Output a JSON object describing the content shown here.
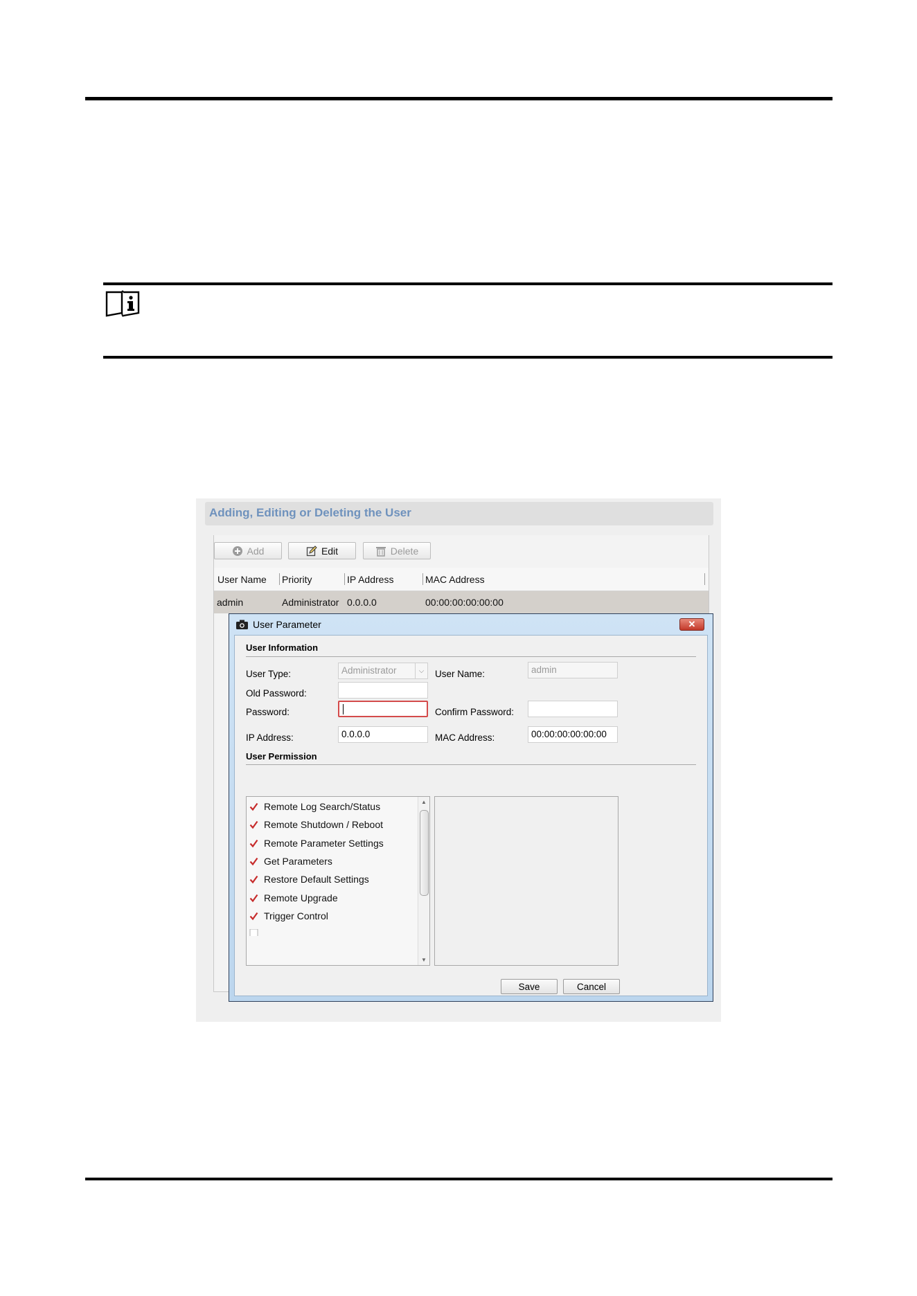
{
  "screenshot": {
    "header_title": "Adding, Editing or Deleting the User",
    "toolbar": {
      "add": "Add",
      "edit": "Edit",
      "delete": "Delete"
    },
    "table": {
      "columns": [
        "User Name",
        "Priority",
        "IP Address",
        "MAC Address"
      ],
      "rows": [
        {
          "user_name": "admin",
          "priority": "Administrator",
          "ip": "0.0.0.0",
          "mac": "00:00:00:00:00:00"
        }
      ]
    },
    "dialog": {
      "title": "User Parameter",
      "section_info": "User Information",
      "user_type_label": "User Type:",
      "user_type_value": "Administrator",
      "user_name_label": "User Name:",
      "user_name_value": "admin",
      "old_password_label": "Old Password:",
      "password_label": "Password:",
      "confirm_password_label": "Confirm Password:",
      "ip_label": "IP Address:",
      "ip_value": "0.0.0.0",
      "mac_label": "MAC Address:",
      "mac_value": "00:00:00:00:00:00",
      "section_permission": "User Permission",
      "permissions": [
        {
          "label": "Remote Log Search/Status",
          "checked": true
        },
        {
          "label": "Remote Shutdown / Reboot",
          "checked": true
        },
        {
          "label": "Remote Parameter Settings",
          "checked": true
        },
        {
          "label": "Get Parameters",
          "checked": true
        },
        {
          "label": "Restore Default Settings",
          "checked": true
        },
        {
          "label": "Remote Upgrade",
          "checked": true
        },
        {
          "label": "Trigger Control",
          "checked": true
        }
      ],
      "save": "Save",
      "cancel": "Cancel"
    }
  },
  "icons": {
    "note": "note-book-icon",
    "add": "plus-circle-icon",
    "edit": "pencil-icon",
    "delete": "trash-icon",
    "dialog": "camera-icon",
    "close": "close-icon",
    "check": "checkmark-icon"
  },
  "colors": {
    "header_title": "#6f92bd",
    "check": "#c62b2b",
    "error_border": "#d44a4a",
    "close_button": "#c3392a"
  }
}
